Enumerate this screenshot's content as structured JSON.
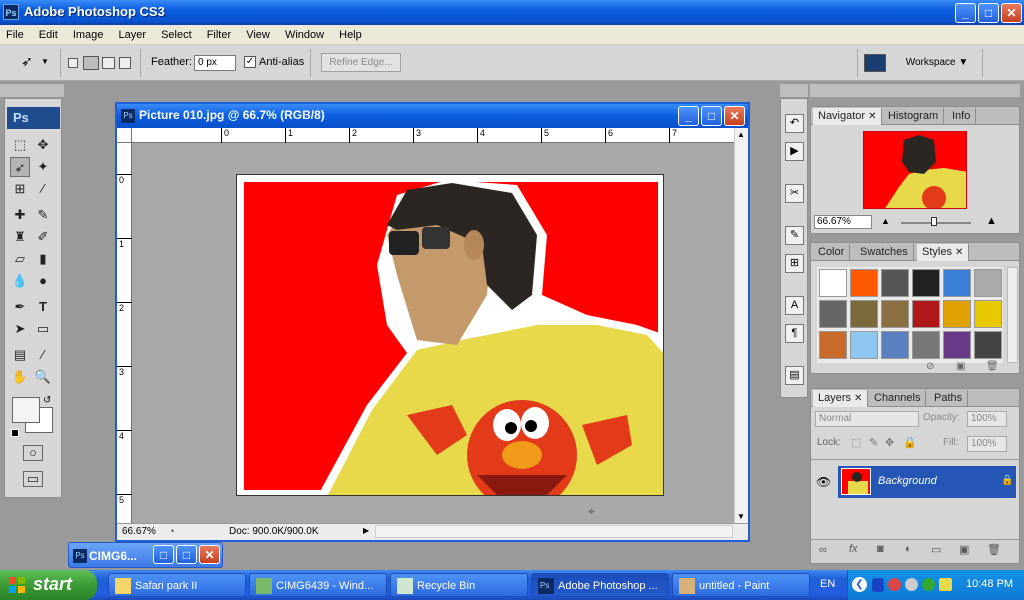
{
  "app": {
    "title": "Adobe Photoshop CS3",
    "badge": "Ps"
  },
  "window_controls": {
    "minimize": "_",
    "maximize": "□",
    "close": "✕"
  },
  "menu": [
    "File",
    "Edit",
    "Image",
    "Layer",
    "Select",
    "Filter",
    "View",
    "Window",
    "Help"
  ],
  "options": {
    "feather_label": "Feather:",
    "feather_value": "0 px",
    "antialias_label": "Anti-alias",
    "antialias_checked": "✓",
    "refine_edge": "Refine Edge...",
    "workspace": "Workspace ▼"
  },
  "toolbox": {
    "logo": "Ps"
  },
  "document": {
    "title": "Picture 010.jpg @ 66.7% (RGB/8)",
    "zoom": "66.67%",
    "doc_info": "Doc: 900.0K/900.0K",
    "ruler_h": [
      "0",
      "1",
      "2",
      "3",
      "4",
      "5",
      "6",
      "7"
    ],
    "ruler_v": [
      "0",
      "1",
      "2",
      "3",
      "4",
      "5"
    ],
    "colors": {
      "background": "#ff0000",
      "shirt": "#e8d94a",
      "elmo": "#e33a1a"
    }
  },
  "minimized_doc": {
    "title": "CIMG6..."
  },
  "navigator_panel": {
    "tabs": [
      "Navigator",
      "Histogram",
      "Info"
    ],
    "zoom": "66.67%"
  },
  "styles_panel": {
    "tabs": [
      "Color",
      "Swatches",
      "Styles"
    ],
    "swatches": [
      "#ffffff",
      "#ff5a00",
      "#555555",
      "#222222",
      "#3a7fd5",
      "#aaaaaa",
      "#666666",
      "#7a6a3a",
      "#8a7040",
      "#b01818",
      "#e0a000",
      "#e8c800",
      "#c86a2a",
      "#8ec8f0",
      "#5a80c0",
      "#777777",
      "#6a3a8a",
      "#444444"
    ]
  },
  "layers_panel": {
    "tabs": [
      "Layers",
      "Channels",
      "Paths"
    ],
    "blend_mode": "Normal",
    "opacity_label": "Opacity:",
    "opacity_value": "100%",
    "lock_label": "Lock:",
    "fill_label": "Fill:",
    "fill_value": "100%",
    "layer_name": "Background"
  },
  "taskbar": {
    "start": "start",
    "tasks": [
      "Safari park II",
      "CIMG6439 - Wind...",
      "Recycle Bin",
      "Adobe Photoshop ...",
      "untitled - Paint"
    ],
    "lang": "EN",
    "clock": "10:48 PM"
  }
}
